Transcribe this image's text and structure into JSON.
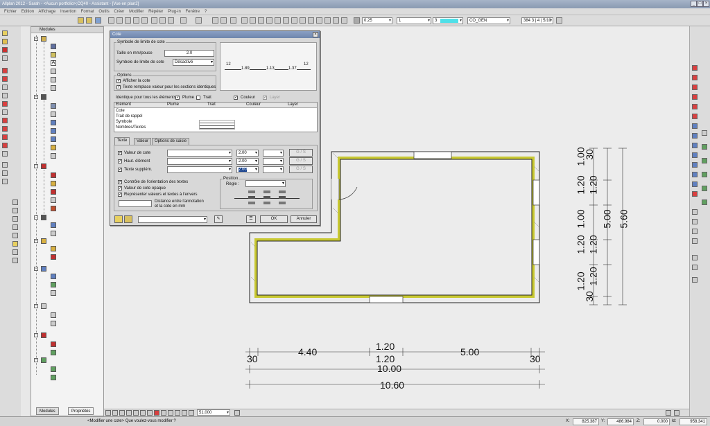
{
  "window": {
    "title": "Allplan 2012 - Sarah - <Aucun portfolio>;CQ40 - Assistant - [Vue en plan2]"
  },
  "menu": [
    "Fichier",
    "Edition",
    "Affichage",
    "Insertion",
    "Format",
    "Outils",
    "Créer",
    "Modifier",
    "Répéter",
    "Plug-in",
    "Fenêtre",
    "?"
  ],
  "toolbar": {
    "pen": "0.25",
    "line": "1",
    "color": "3",
    "layer": "CO_GEN",
    "scale": "384",
    "scale_label": "3 | 4 | 5/10"
  },
  "modules_panel": {
    "title": "Modules",
    "tabs": [
      "Modules",
      "Propriétés"
    ]
  },
  "dialog": {
    "title": "Cote",
    "symbol_group": "Symbole de limite de cote",
    "size_label": "Taille en mm/pouce",
    "size_value": "2.0",
    "symbol_label": "Symbole de limite de cote",
    "symbol_value": "Désactivé",
    "preview": [
      "12",
      "1.89",
      "1.13",
      "1.37",
      "12"
    ],
    "options_group": "Options",
    "opt_show": "Afficher la cote",
    "opt_replace": "Texte remplace valeur pour les sections identiques",
    "identical_label": "Identique pour tous les éléments",
    "identical_opts": [
      "Plume",
      "Trait",
      "Couleur",
      "Layer"
    ],
    "table_headers": [
      "Elément",
      "Plume",
      "Trait",
      "Couleur",
      "Layer"
    ],
    "table_rows": [
      "Cote",
      "Trait de rappel",
      "Symbole",
      "Nombres/Textes"
    ],
    "tabs": [
      "Texte",
      "Valeur",
      "Options de saisie"
    ],
    "text_rows": [
      {
        "label": "Valeur de cote",
        "size": "2.00"
      },
      {
        "label": "Haut. élément",
        "size": "2.00"
      },
      {
        "label": "Texte supplém.",
        "size": "2.00"
      }
    ],
    "checks": [
      "Contrôle de l'orientation des textes",
      "Valeur de cote opaque",
      "Représenter valeurs et textes à l'envers"
    ],
    "distance_label_1": "Distance entre l'annotation",
    "distance_label_2": "et la cote en mm",
    "position_group": "Position",
    "rule_label": "Règle :",
    "ok": "OK",
    "cancel": "Annuler"
  },
  "drawing": {
    "vertical_dims_1": [
      "30",
      "1.20",
      "1.20",
      "1.20",
      "30"
    ],
    "vertical_dims_2": [
      "1.00",
      "1.20",
      "1.00",
      "1.20",
      "1.20"
    ],
    "vertical_total_1": "5.00",
    "vertical_total_2": "5.60",
    "h_top": [
      "1.20"
    ],
    "h_row1": [
      "30",
      "4.40",
      "1.20",
      "5.00",
      "30"
    ],
    "h_row2": "10.00",
    "h_row3": "10.60",
    "wall_color": "#c8c832"
  },
  "viewbar": {
    "zoom": "51.000"
  },
  "status": {
    "prompt": "<Modifier une cote> Que voulez-vous modifier ?",
    "x_label": "X:",
    "x": "825.387",
    "y_label": "Y:",
    "y": "486.984",
    "z_label": "Z:",
    "z": "0.000",
    "d_label": "ld:",
    "d": "958.341"
  }
}
